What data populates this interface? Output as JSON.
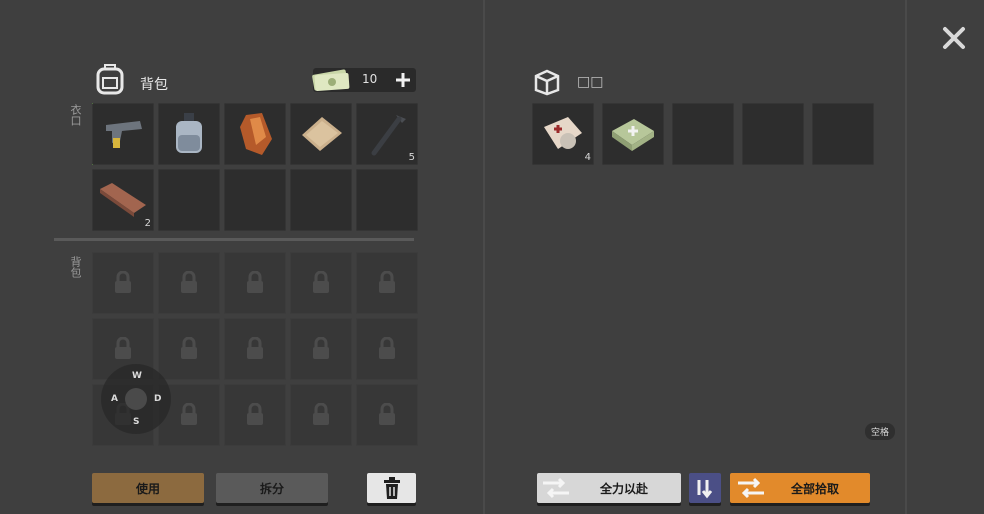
{
  "backpack": {
    "title": "背包",
    "pocket_label": "衣口",
    "bag_label": "背包",
    "currency_amount": "10",
    "pocket_items": [
      {
        "name": "pistol-icon",
        "count": ""
      },
      {
        "name": "canister-icon",
        "count": ""
      },
      {
        "name": "ore-icon",
        "count": ""
      },
      {
        "name": "cloth-icon",
        "count": ""
      },
      {
        "name": "nail-icon",
        "count": "5"
      },
      {
        "name": "plank-icon",
        "count": "2"
      }
    ]
  },
  "storage": {
    "title": "□□",
    "items": [
      {
        "name": "bandage-icon",
        "count": "4"
      },
      {
        "name": "first-aid-kit-icon",
        "count": ""
      }
    ]
  },
  "wasd": {
    "w": "W",
    "a": "A",
    "s": "S",
    "d": "D"
  },
  "space_hint": "空格",
  "buttons": {
    "use": "使用",
    "split": "拆分",
    "all_out": "全力以赴",
    "take_all": "全部拾取"
  },
  "colors": {
    "use_button": "#8c6a3f",
    "split_button": "#5a5a5a",
    "take_all_button": "#e28a2b",
    "sort_button": "#4b4f86",
    "all_out_button": "#d7d7d7"
  }
}
